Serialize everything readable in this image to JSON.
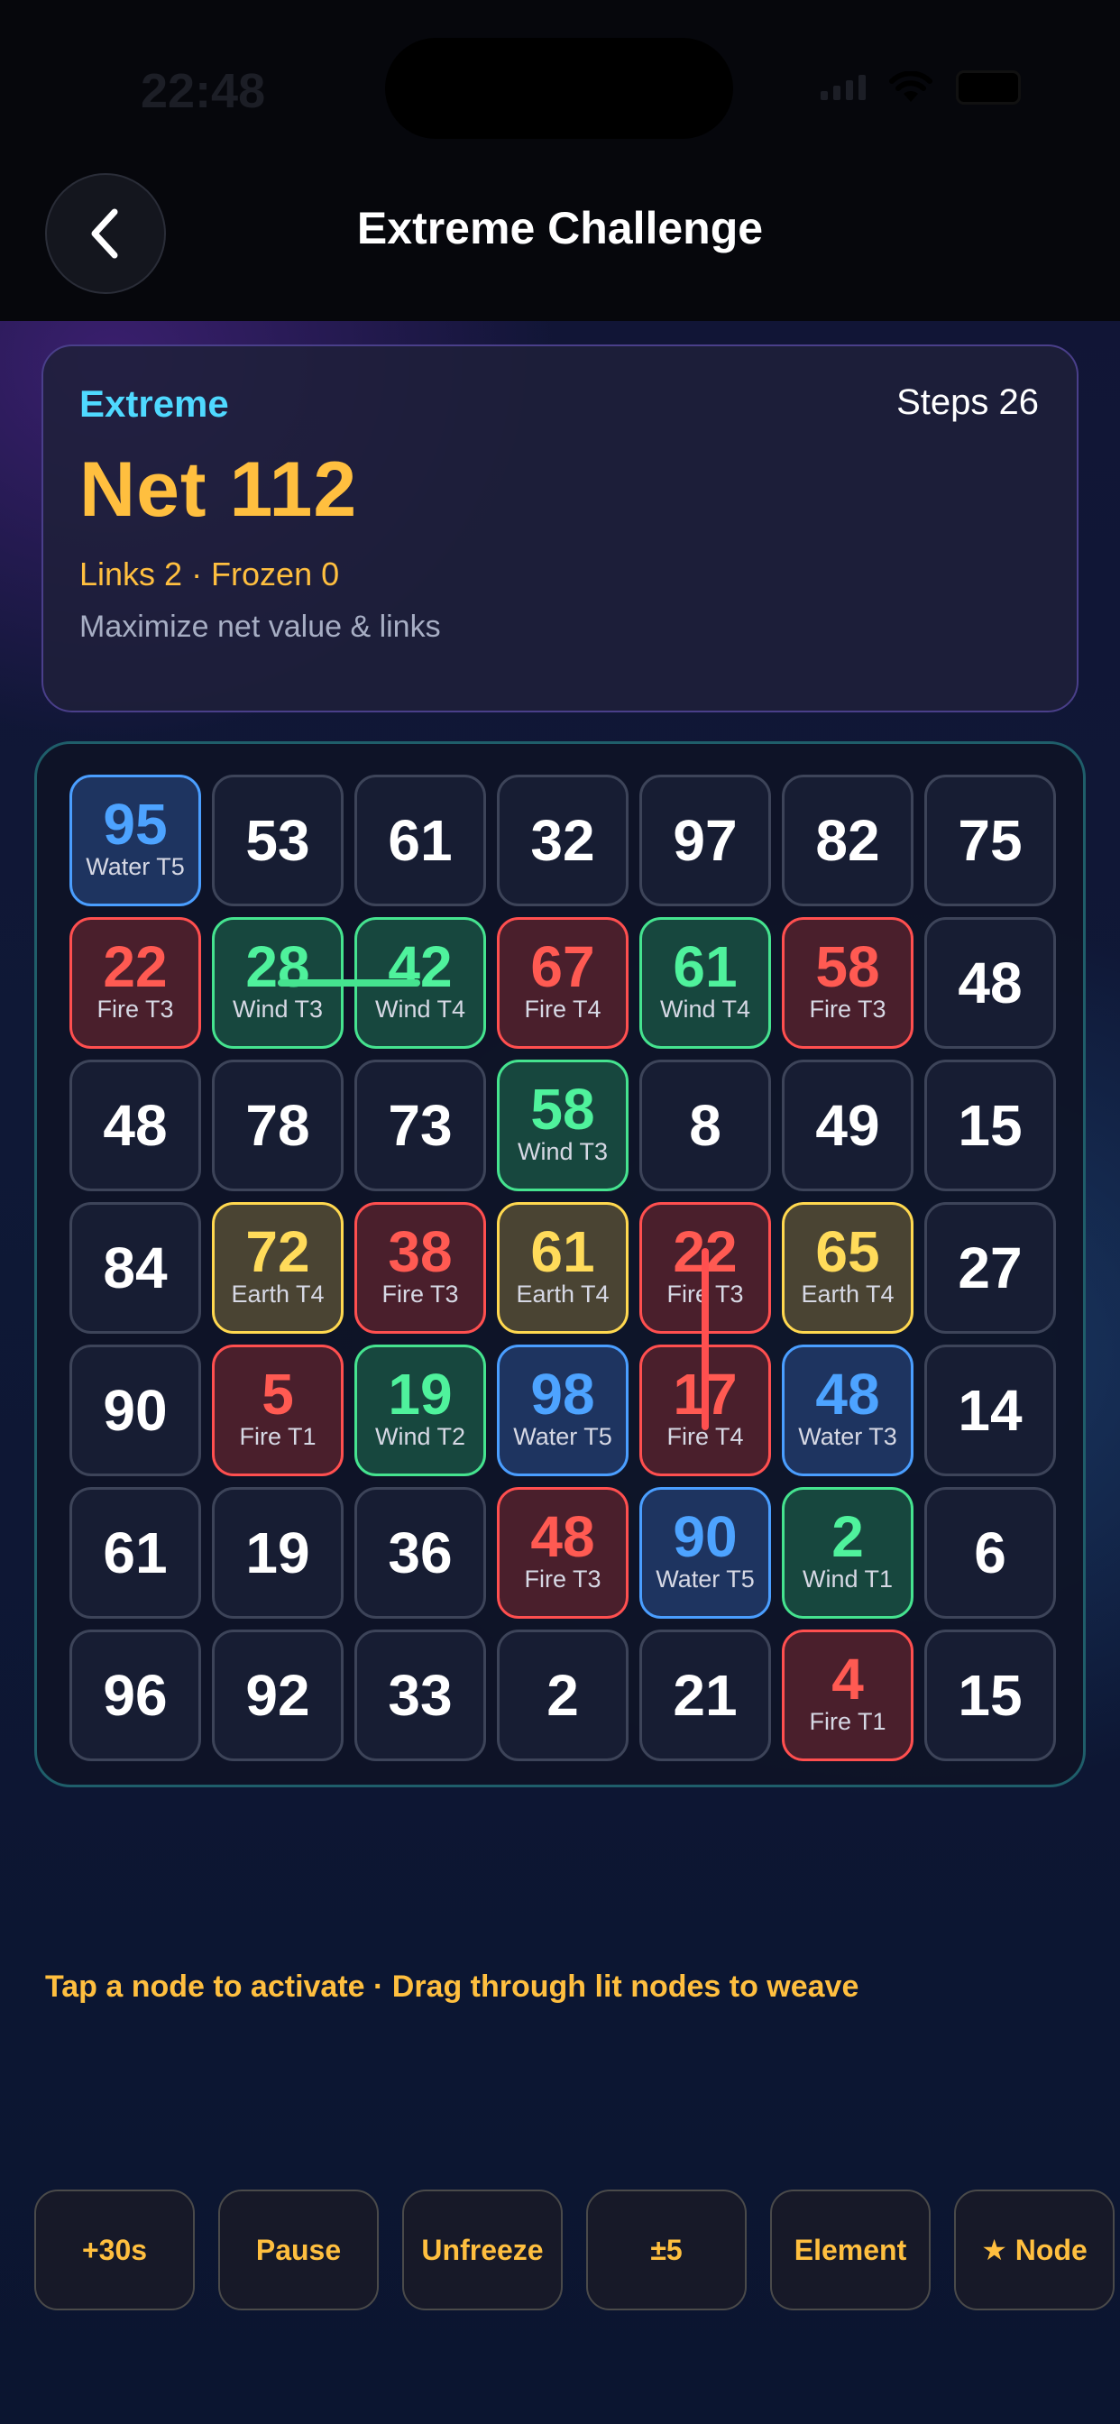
{
  "status_bar": {
    "time": "22:48"
  },
  "header": {
    "title": "Extreme Challenge"
  },
  "info": {
    "mode": "Extreme",
    "steps": "Steps 26",
    "net": "Net 112",
    "links_frozen": "Links 2 · Frozen 0",
    "hint": "Maximize net value & links"
  },
  "board": {
    "rows": [
      [
        {
          "v": "95",
          "t": "water",
          "s": "Water T5"
        },
        {
          "v": "53"
        },
        {
          "v": "61"
        },
        {
          "v": "32"
        },
        {
          "v": "97"
        },
        {
          "v": "82"
        },
        {
          "v": "75"
        }
      ],
      [
        {
          "v": "22",
          "t": "fire",
          "s": "Fire T3"
        },
        {
          "v": "28",
          "t": "wind",
          "s": "Wind T3"
        },
        {
          "v": "42",
          "t": "wind",
          "s": "Wind T4"
        },
        {
          "v": "67",
          "t": "fire",
          "s": "Fire T4"
        },
        {
          "v": "61",
          "t": "wind",
          "s": "Wind T4"
        },
        {
          "v": "58",
          "t": "fire",
          "s": "Fire T3"
        },
        {
          "v": "48"
        }
      ],
      [
        {
          "v": "48"
        },
        {
          "v": "78"
        },
        {
          "v": "73"
        },
        {
          "v": "58",
          "t": "wind",
          "s": "Wind T3"
        },
        {
          "v": "8"
        },
        {
          "v": "49"
        },
        {
          "v": "15"
        }
      ],
      [
        {
          "v": "84"
        },
        {
          "v": "72",
          "t": "earth",
          "s": "Earth T4"
        },
        {
          "v": "38",
          "t": "fire",
          "s": "Fire T3"
        },
        {
          "v": "61",
          "t": "earth",
          "s": "Earth T4"
        },
        {
          "v": "22",
          "t": "fire",
          "s": "Fire T3"
        },
        {
          "v": "65",
          "t": "earth",
          "s": "Earth T4"
        },
        {
          "v": "27"
        }
      ],
      [
        {
          "v": "90"
        },
        {
          "v": "5",
          "t": "fire",
          "s": "Fire T1"
        },
        {
          "v": "19",
          "t": "wind",
          "s": "Wind T2"
        },
        {
          "v": "98",
          "t": "water",
          "s": "Water T5"
        },
        {
          "v": "17",
          "t": "fire",
          "s": "Fire T4"
        },
        {
          "v": "48",
          "t": "water",
          "s": "Water T3"
        },
        {
          "v": "14"
        }
      ],
      [
        {
          "v": "61"
        },
        {
          "v": "19"
        },
        {
          "v": "36"
        },
        {
          "v": "48",
          "t": "fire",
          "s": "Fire T3"
        },
        {
          "v": "90",
          "t": "water",
          "s": "Water T5"
        },
        {
          "v": "2",
          "t": "wind",
          "s": "Wind T1"
        },
        {
          "v": "6"
        }
      ],
      [
        {
          "v": "96"
        },
        {
          "v": "92"
        },
        {
          "v": "33"
        },
        {
          "v": "2"
        },
        {
          "v": "21"
        },
        {
          "v": "4",
          "t": "fire",
          "s": "Fire T1"
        },
        {
          "v": "15"
        }
      ]
    ],
    "links": [
      {
        "from": [
          1,
          1
        ],
        "to": [
          1,
          2
        ],
        "color": "wind"
      },
      {
        "from": [
          3,
          4
        ],
        "to": [
          4,
          4
        ],
        "color": "fire"
      }
    ]
  },
  "instruction": "Tap a node to activate · Drag through lit nodes to weave",
  "actions": [
    "+30s",
    "Pause",
    "Unfreeze",
    "±5",
    "Element",
    "★ Node"
  ],
  "colors": {
    "water": "#4a9eff",
    "fire": "#ff4f4f",
    "wind": "#45e38f",
    "earth": "#ffd84f",
    "accent": "#ffbf3f"
  }
}
